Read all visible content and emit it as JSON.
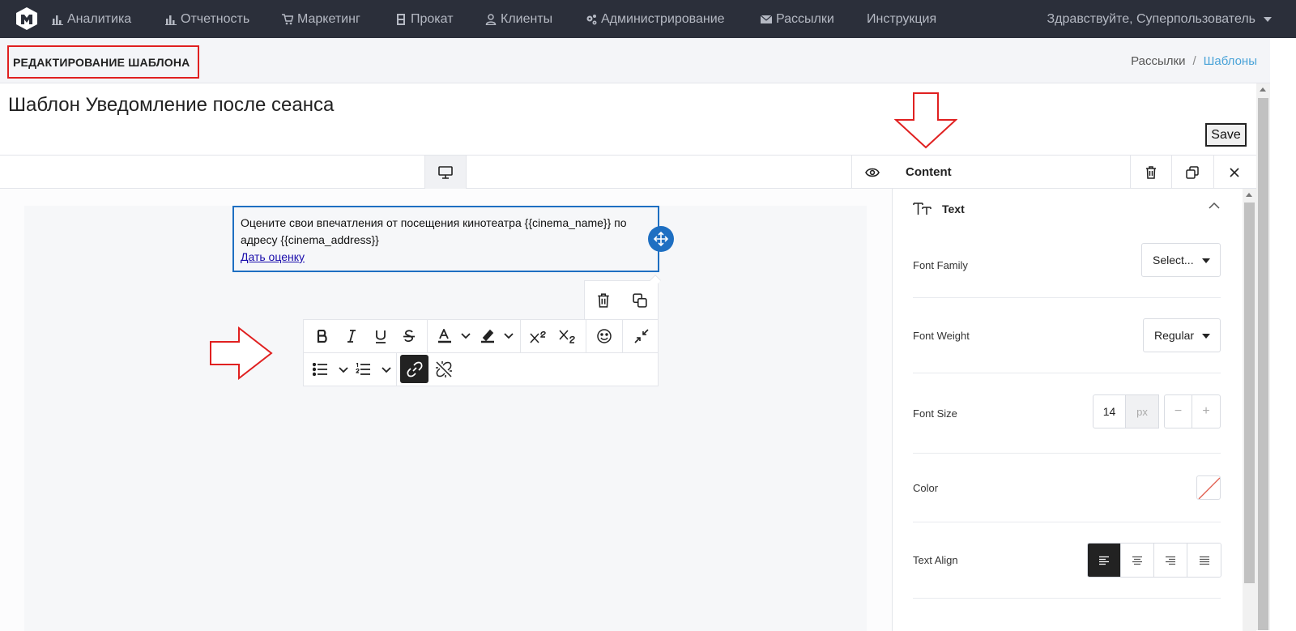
{
  "navbar": {
    "items": [
      {
        "label": "Аналитика",
        "icon": "bar-chart-icon"
      },
      {
        "label": "Отчетность",
        "icon": "bar-chart-icon"
      },
      {
        "label": "Маркетинг",
        "icon": "cart-icon"
      },
      {
        "label": "Прокат",
        "icon": "film-icon"
      },
      {
        "label": "Клиенты",
        "icon": "user-icon"
      },
      {
        "label": "Администрирование",
        "icon": "gears-icon"
      },
      {
        "label": "Рассылки",
        "icon": "envelope-icon"
      },
      {
        "label": "Инструкция",
        "icon": ""
      }
    ],
    "user_greeting": "Здравствуйте, Суперпользователь"
  },
  "subheader": {
    "heading": "РЕДАКТИРОВАНИЕ ШАБЛОНА",
    "breadcrumb": [
      "Рассылки",
      "Шаблоны"
    ]
  },
  "main": {
    "template_title": "Шаблон Уведомление после сеанса",
    "save_label": "Save"
  },
  "canvas": {
    "text_line": "Оцените свои впечатления от посещения кинотеатра {{cinema_name}} по адресу {{cinema_address}}",
    "link_text": "Дать оценку"
  },
  "panel": {
    "title": "Content",
    "section_title": "Text",
    "font_family_label": "Font Family",
    "font_family_value": "Select...",
    "font_weight_label": "Font Weight",
    "font_weight_value": "Regular",
    "font_size_label": "Font Size",
    "font_size_value": "14",
    "font_size_unit": "px",
    "minus": "−",
    "plus": "+",
    "color_label": "Color",
    "text_align_label": "Text Align",
    "text_align_value": "left"
  },
  "colors": {
    "navbar_bg": "#2b2f3a",
    "accent": "#1e6fc2",
    "annotation": "#e02020",
    "breadcrumb_active": "#4aa3d8"
  }
}
